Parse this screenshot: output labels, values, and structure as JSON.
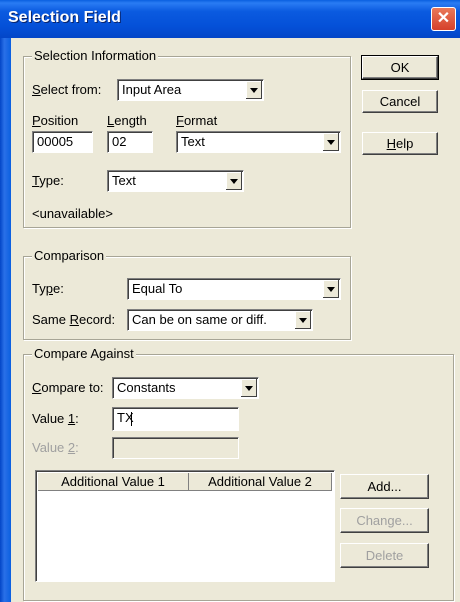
{
  "window": {
    "title": "Selection Field",
    "close_glyph": "✕"
  },
  "buttons": {
    "ok": "OK",
    "cancel": "Cancel",
    "help": "Help",
    "add": "Add...",
    "change": "Change...",
    "delete": "Delete"
  },
  "selection_info": {
    "legend": "Selection Information",
    "select_from_label": "Select from:",
    "select_from_value": "Input Area",
    "position_label": "Position",
    "position_value": "00005",
    "length_label": "Length",
    "length_value": "02",
    "format_label": "Format",
    "format_value": "Text",
    "type_label": "Type:",
    "type_value": "Text",
    "status": "<unavailable>"
  },
  "comparison": {
    "legend": "Comparison",
    "type_label": "Type:",
    "type_value": "Equal To",
    "same_record_label": "Same Record:",
    "same_record_value": "Can be on same or diff."
  },
  "compare_against": {
    "legend": "Compare Against",
    "compare_to_label": "Compare to:",
    "compare_to_value": "Constants",
    "value1_label": "Value 1:",
    "value1_value": "TX",
    "value2_label": "Value 2:",
    "value2_value": "",
    "columns": [
      "Additional Value 1",
      "Additional Value 2"
    ]
  }
}
